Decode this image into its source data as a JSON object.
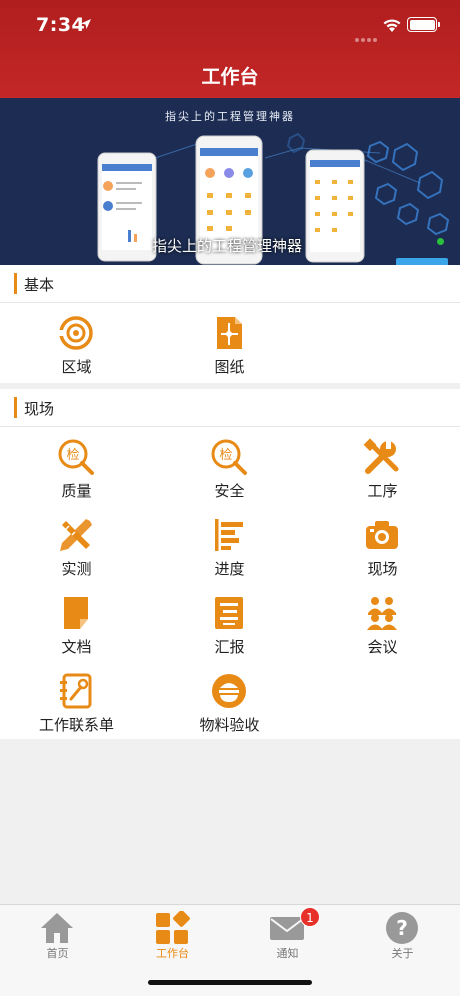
{
  "status_bar": {
    "time": "7:34"
  },
  "header": {
    "title": "工作台"
  },
  "banner": {
    "subtitle": "指尖上的工程管理神器",
    "caption": "指尖上的工程管理神器"
  },
  "sections": {
    "basic": {
      "title": "基本",
      "items": [
        {
          "label": "区域",
          "icon": "target-icon"
        },
        {
          "label": "图纸",
          "icon": "drawing-icon"
        }
      ]
    },
    "site": {
      "title": "现场",
      "items": [
        {
          "label": "质量",
          "icon": "inspect-icon"
        },
        {
          "label": "安全",
          "icon": "inspect-icon"
        },
        {
          "label": "工序",
          "icon": "tools-icon"
        },
        {
          "label": "实测",
          "icon": "ruler-pencil-icon"
        },
        {
          "label": "进度",
          "icon": "progress-bars-icon"
        },
        {
          "label": "现场",
          "icon": "camera-icon"
        },
        {
          "label": "文档",
          "icon": "document-icon"
        },
        {
          "label": "汇报",
          "icon": "report-icon"
        },
        {
          "label": "会议",
          "icon": "meeting-icon"
        },
        {
          "label": "工作联系单",
          "icon": "contact-form-icon"
        },
        {
          "label": "物料验收",
          "icon": "material-icon"
        }
      ]
    }
  },
  "tabbar": {
    "tabs": [
      {
        "label": "首页",
        "icon": "home-icon"
      },
      {
        "label": "工作台",
        "icon": "workbench-icon",
        "active": true
      },
      {
        "label": "通知",
        "icon": "mail-icon",
        "badge": "1"
      },
      {
        "label": "关于",
        "icon": "help-icon"
      }
    ]
  },
  "colors": {
    "header": "#c42727",
    "accent": "#e88a16",
    "badge": "#e8302a"
  }
}
